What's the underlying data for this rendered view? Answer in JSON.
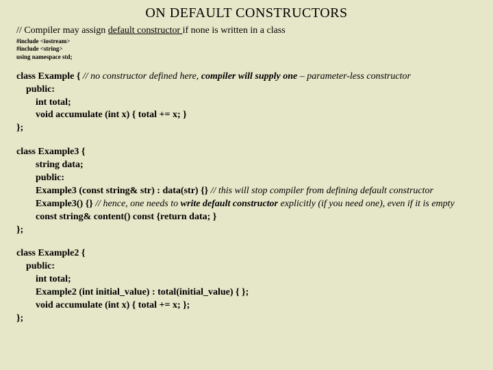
{
  "title": "ON DEFAULT CONSTRUCTORS",
  "intro_prefix": "// Compiler may assign ",
  "intro_underline": "default constructor ",
  "intro_suffix": "if none is written in a class",
  "includes": {
    "l1": "#include <iostream>",
    "l2": "#include <string>",
    "l3": "using namespace std;"
  },
  "ex1": {
    "head_code": "class Example {   ",
    "head_comment": "// no constructor defined here, ",
    "head_comment_b": "compiler will supply one",
    "head_comment_tail": " – parameter-less constructor",
    "l_public": "public:",
    "l_total": "int  total;",
    "l_acc": "void  accumulate (int x) { total  +=  x;  }",
    "l_close": "};"
  },
  "ex3": {
    "l_head": "class Example3 {",
    "l_data": "string  data;",
    "l_public": "public:",
    "ctor1_b": "Example3  (const  string&  str) : data(str) {}",
    "ctor1_c": " // this will stop compiler from defining default constructor",
    "ctor2_b": "Example3() {}",
    "ctor2_c1": " // hence, one needs to ",
    "ctor2_cb": "write default constructor",
    "ctor2_c2": " explicitly (if you need one), even if it is empty",
    "l_content": "const  string&  content()  const  {return data;  }",
    "l_close": "};"
  },
  "ex2": {
    "l_head": "class Example2 {",
    "l_public": "public:",
    "l_total": "int  total;",
    "ctor_b": "Example2  (int  initial_value) : total(initial_value) { };",
    "l_acc": "void  accumulate (int x) { total  +=  x;  };",
    "l_close": "};"
  }
}
